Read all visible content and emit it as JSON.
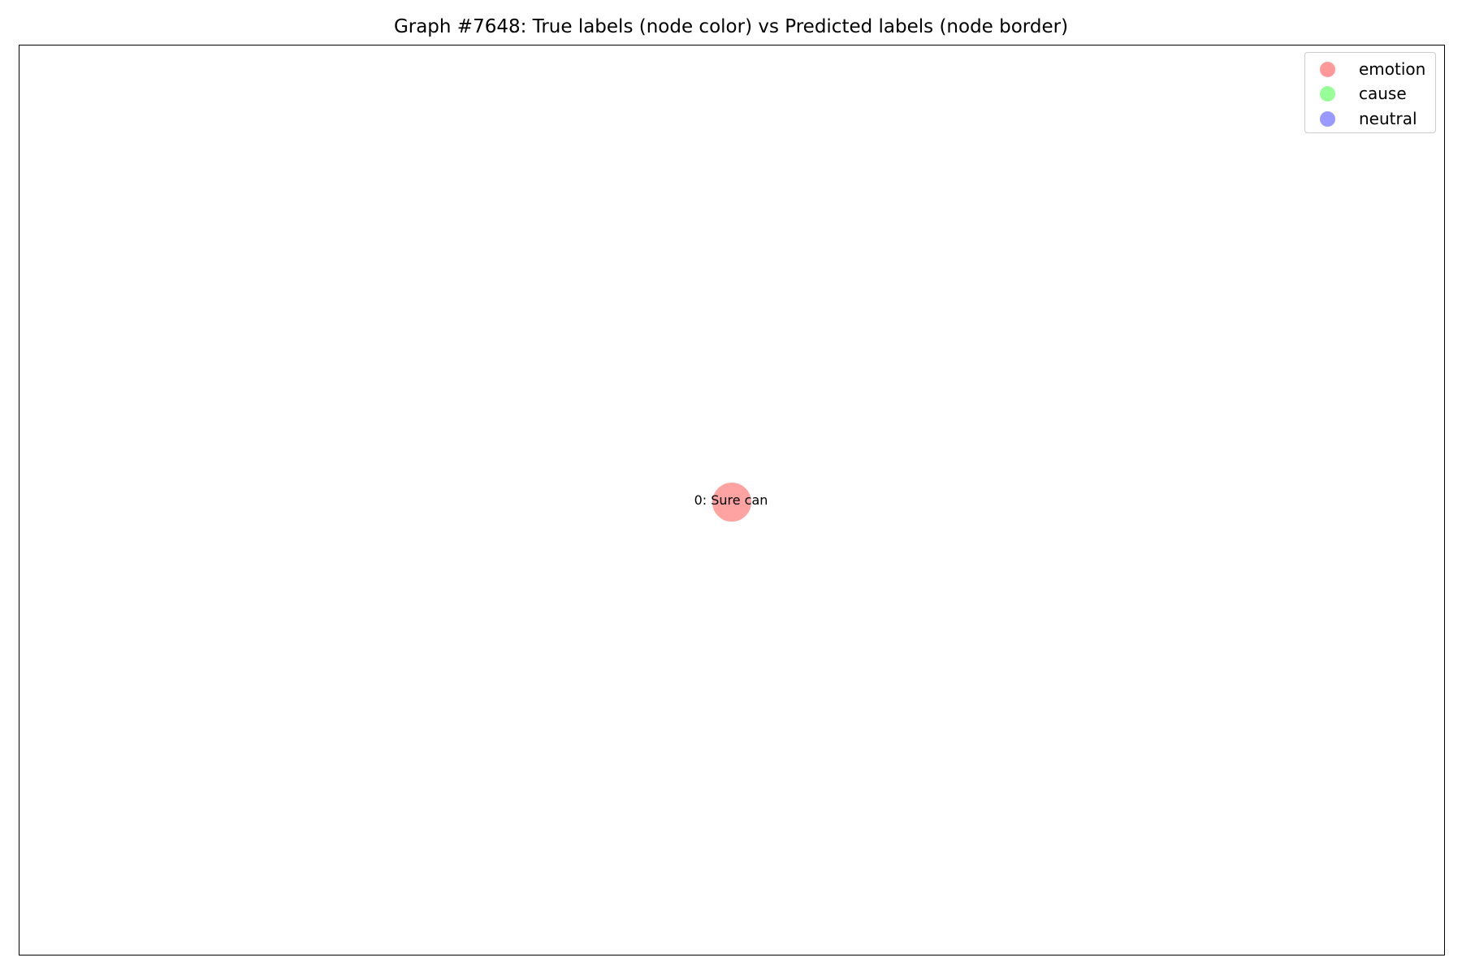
{
  "figure": {
    "title": "Graph #7648: True labels (node color) vs Predicted labels (node border)"
  },
  "legend": {
    "items": [
      {
        "label": "emotion",
        "color": "#ff9999"
      },
      {
        "label": "cause",
        "color": "#99ff99"
      },
      {
        "label": "neutral",
        "color": "#9999ff"
      }
    ]
  },
  "graph": {
    "nodes": [
      {
        "label": "0: Sure can",
        "true_label": "emotion",
        "predicted_label": "emotion",
        "fill_color": "#ff9999",
        "border_color": "#ff9999"
      }
    ],
    "edges": []
  }
}
